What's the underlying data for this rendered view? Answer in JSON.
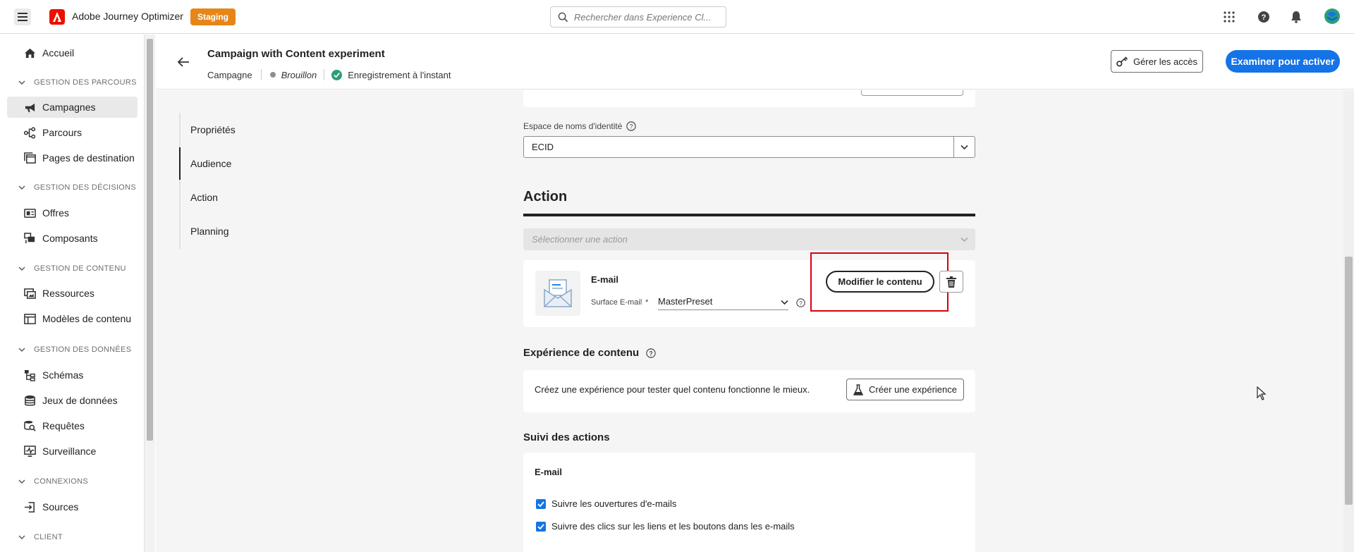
{
  "topbar": {
    "app_name": "Adobe Journey Optimizer",
    "env_badge": "Staging",
    "search_placeholder": "Rechercher dans Experience Cl..."
  },
  "sidebar": {
    "home": "Accueil",
    "sections": {
      "parcours": "GESTION DES PARCOURS",
      "decisions": "GESTION DES DÉCISIONS",
      "contenu": "GESTION DE CONTENU",
      "donnees": "GESTION DES DONNÉES",
      "connexions": "CONNEXIONS",
      "client": "CLIENT"
    },
    "items": {
      "campagnes": "Campagnes",
      "parcours": "Parcours",
      "pages": "Pages de destination",
      "offres": "Offres",
      "composants": "Composants",
      "ressources": "Ressources",
      "modeles": "Modèles de contenu",
      "schemas": "Schémas",
      "jeux": "Jeux de données",
      "requetes": "Requêtes",
      "surveillance": "Surveillance",
      "sources": "Sources"
    }
  },
  "header": {
    "title": "Campaign with Content experiment",
    "type": "Campagne",
    "status": "Brouillon",
    "saved": "Enregistrement à l'instant",
    "manage_access": "Gérer les accès",
    "review": "Examiner pour activer"
  },
  "toc": {
    "items": [
      "Propriétés",
      "Audience",
      "Action",
      "Planning"
    ]
  },
  "identity": {
    "label": "Espace de noms d'identité",
    "value": "ECID"
  },
  "action": {
    "heading": "Action",
    "select_placeholder": "Sélectionner une action",
    "channel": "E-mail",
    "surface_label": "Surface E-mail",
    "required_mark": "*",
    "surface_value": "MasterPreset",
    "edit_content": "Modifier le contenu"
  },
  "experiment": {
    "heading": "Expérience de contenu",
    "description": "Créez une expérience pour tester quel contenu fonctionne le mieux.",
    "create_button": "Créer une expérience"
  },
  "tracking": {
    "heading": "Suivi des actions",
    "sub": "E-mail",
    "opt1": "Suivre les ouvertures d'e-mails",
    "opt2": "Suivre des clics sur les liens et les boutons dans les e-mails"
  },
  "colors": {
    "accent": "#1473e6",
    "highlight": "#d7000f",
    "success": "#2d9d78",
    "badge": "#e68619"
  }
}
